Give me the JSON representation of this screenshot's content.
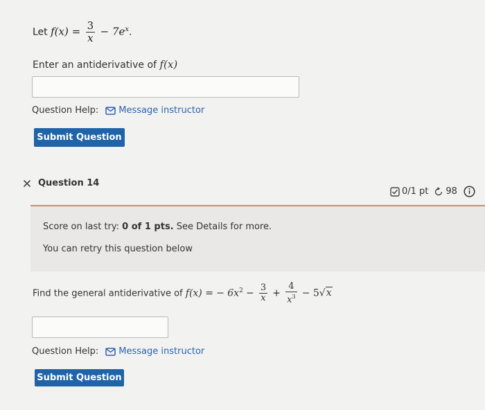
{
  "q13": {
    "let_text": "Let",
    "f_label": "f(x) =",
    "frac_num": "3",
    "frac_den": "x",
    "rest": "− 7e",
    "exp": "x",
    "period": ".",
    "prompt": "Enter an antiderivative of",
    "prompt_f": "f(x)",
    "help_label": "Question Help:",
    "message_label": "Message instructor",
    "submit_label": "Submit Question"
  },
  "q14": {
    "title": "Question 14",
    "status_icon": "x-mark-icon",
    "score": "0/1 pt",
    "retries": "98",
    "feedback_line1_pre": "Score on last try:",
    "feedback_line1_bold": "0 of 1 pts.",
    "feedback_line1_post": "See Details for more.",
    "feedback_line2": "You can retry this question below",
    "prompt": "Find the general antiderivative of",
    "f_label": "f(x) =",
    "term1": "− 6x",
    "term1_exp": "2",
    "minus1": "−",
    "frac1_num": "3",
    "frac1_den": "x",
    "plus": "+",
    "frac2_num": "4",
    "frac2_den": "x",
    "frac2_den_exp": "3",
    "term_last": "− 5",
    "sqrt_arg": "x",
    "help_label": "Question Help:",
    "message_label": "Message instructor",
    "submit_label": "Submit Question"
  },
  "colors": {
    "accent": "#1f63a8",
    "link": "#2b62b0",
    "error": "#d7837a"
  }
}
